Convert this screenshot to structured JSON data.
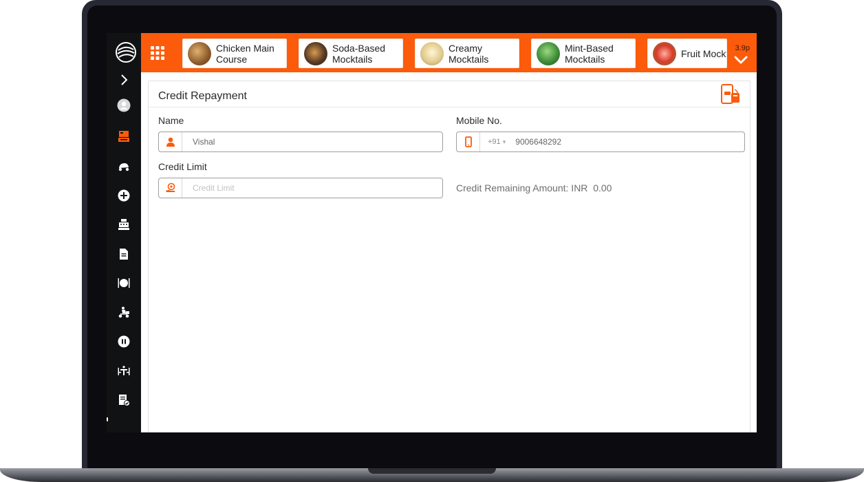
{
  "topbar": {
    "categories": [
      {
        "label": "Chicken Main Course",
        "thumb_color": "#8a5a2a"
      },
      {
        "label": "Soda-Based Mocktails",
        "thumb_color": "#5a3a24"
      },
      {
        "label": "Creamy Mocktails",
        "thumb_color": "#cfbb86"
      },
      {
        "label": "Mint-Based Mocktails",
        "thumb_color": "#3f8e3a"
      },
      {
        "label": "Fruit Mockt",
        "thumb_color": "#d93a2a"
      }
    ],
    "scroll_badge": "3.9p"
  },
  "form": {
    "title": "Credit Repayment",
    "name_label": "Name",
    "name_value": "Vishal",
    "mobile_label": "Mobile No.",
    "country_code": "+91",
    "mobile_value": "9006648292",
    "credit_limit_label": "Credit Limit",
    "credit_limit_placeholder": "Credit Limit",
    "credit_remaining": "Credit Remaining Amount: INR  0.00"
  },
  "colors": {
    "accent": "#fb5b0b",
    "sidebar": "#111214"
  }
}
